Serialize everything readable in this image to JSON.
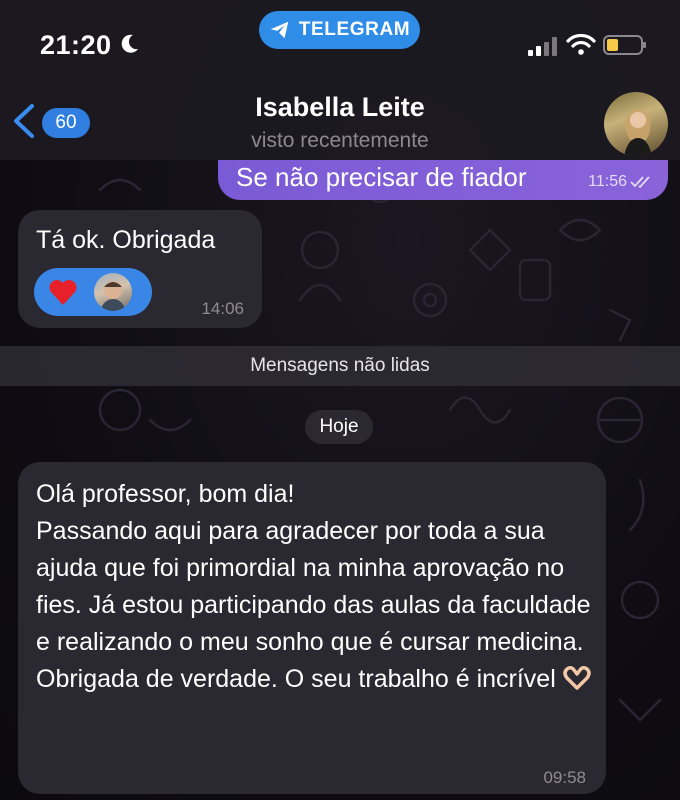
{
  "status_bar": {
    "time": "21:20",
    "app_pill": "TELEGRAM"
  },
  "header": {
    "back_count": "60",
    "contact_name": "Isabella Leite",
    "contact_status": "visto recentemente"
  },
  "messages": [
    {
      "direction": "outgoing",
      "text": "Se não precisar de fiador",
      "time": "11:56",
      "read": true
    },
    {
      "direction": "incoming",
      "text": "Tá ok. Obrigada",
      "time": "14:06",
      "reaction": "heart"
    },
    {
      "direction": "incoming",
      "text": "Olá professor, bom dia!\nPassando aqui para agradecer por toda a sua ajuda que foi primordial na minha aprovação no fies. Já estou participando das aulas da faculdade e realizando o meu sonho que é cursar medicina. Obrigada de verdade. O seu trabalho é incrível",
      "time": "09:58",
      "emoji": "heart-hands"
    }
  ],
  "dividers": {
    "unread": "Mensagens não lidas",
    "date": "Hoje"
  },
  "colors": {
    "accent": "#2f8de8",
    "outgoing_bubble": "#8060d8",
    "incoming_bubble": "#2a2830"
  }
}
